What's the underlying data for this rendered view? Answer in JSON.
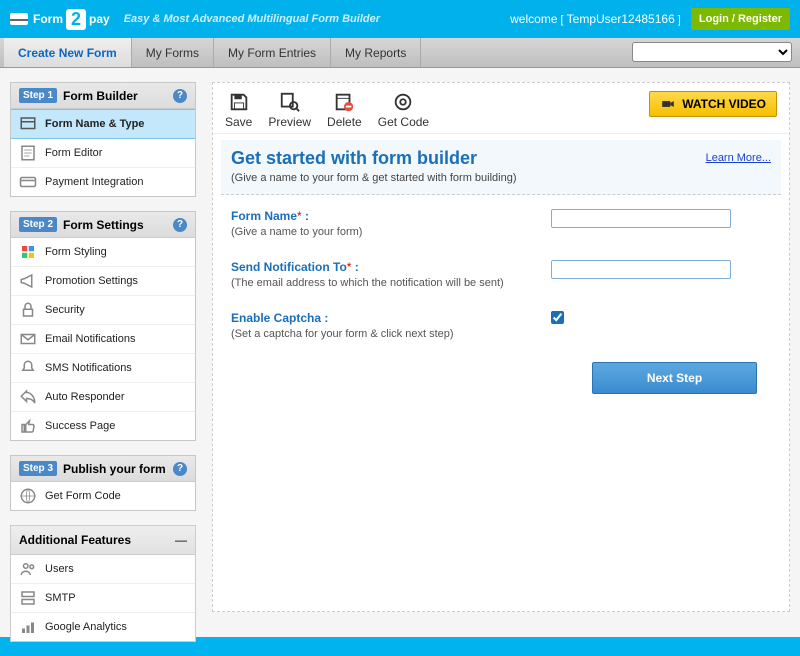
{
  "header": {
    "brand_pre": "Form",
    "brand_two": "2",
    "brand_post": "pay",
    "tagline": "Easy & Most Advanced Multilingual Form Builder",
    "welcome": "welcome",
    "user": "TempUser12485166",
    "login": "Login / Register"
  },
  "nav": {
    "items": [
      "Create New Form",
      "My Forms",
      "My Form Entries",
      "My Reports"
    ]
  },
  "sidebar": {
    "step1": {
      "tag": "Step 1",
      "title": "Form Builder",
      "items": [
        "Form Name & Type",
        "Form Editor",
        "Payment Integration"
      ]
    },
    "step2": {
      "tag": "Step 2",
      "title": "Form Settings",
      "items": [
        "Form Styling",
        "Promotion Settings",
        "Security",
        "Email Notifications",
        "SMS Notifications",
        "Auto Responder",
        "Success Page"
      ]
    },
    "step3": {
      "tag": "Step 3",
      "title": "Publish your form",
      "items": [
        "Get Form Code"
      ]
    },
    "additional": {
      "title": "Additional Features",
      "items": [
        "Users",
        "SMTP",
        "Google Analytics"
      ]
    }
  },
  "toolbar": {
    "save": "Save",
    "preview": "Preview",
    "delete": "Delete",
    "getcode": "Get Code",
    "watch": "WATCH VIDEO"
  },
  "main": {
    "intro_title": "Get started with form builder",
    "intro_sub": "(Give a name to your form & get started with form building)",
    "learn_more": "Learn More...",
    "required_mark": "*",
    "fields": [
      {
        "label": "Form Name",
        "hint": "(Give a name to your form)"
      },
      {
        "label": "Send Notification To",
        "hint": "(The email address to which the notification will be sent)"
      },
      {
        "label": "Enable Captcha",
        "hint": "(Set a captcha for your form & click next step)"
      }
    ],
    "next_label": "Next Step"
  }
}
